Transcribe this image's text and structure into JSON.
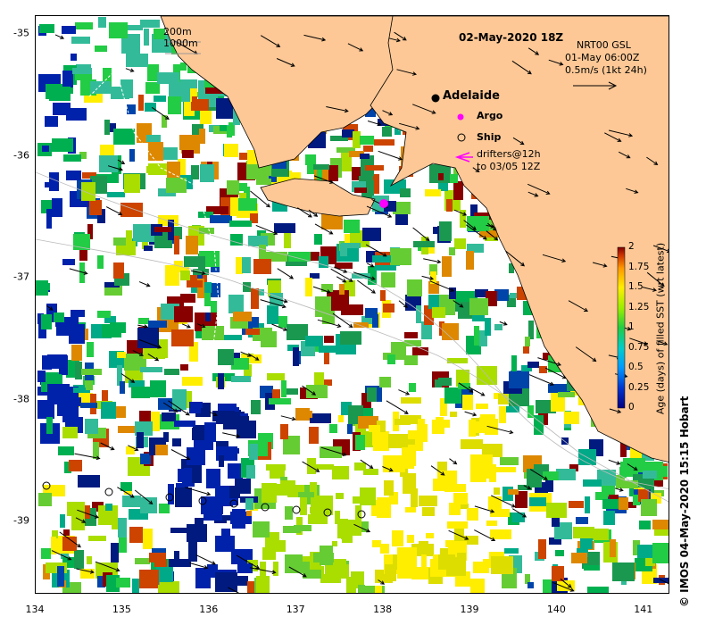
{
  "map": {
    "title": "02-May-2020 18Z",
    "x_ticks": [
      "134",
      "135",
      "136",
      "137",
      "138",
      "139",
      "140",
      "141"
    ],
    "y_ticks": [
      "-35",
      "-36",
      "-37",
      "-38",
      "-39"
    ],
    "x_range": [
      134,
      141.3
    ],
    "y_range": [
      -39.6,
      -34.85
    ],
    "legend": {
      "bathy_200": "200m",
      "bathy_1000": "1000m",
      "model": "NRT00 GSL",
      "model_time": "01-May 06:00Z",
      "current_scale": "0.5m/s (1kt 24h)"
    },
    "places": {
      "city": "Adelaide",
      "argo": "Argo",
      "ship": "Ship",
      "drifters_line1": "drifters@12h",
      "drifters_line2": "to 03/05 12Z"
    },
    "colorbar": {
      "title": "Age (days) of filled SST (wrt latest)",
      "ticks": [
        "2",
        "1.75",
        "1.5",
        "1.25",
        "1",
        "0.75",
        "0.5",
        "0.25",
        "0"
      ],
      "range": [
        0,
        2
      ]
    },
    "credit": "© IMOS 04-May-2020 15:15 Hobart",
    "colors": {
      "land": "#fdc896",
      "ocean": "#ffffff",
      "argo": "#ff00ff",
      "drifter": "#ff00ff"
    }
  }
}
